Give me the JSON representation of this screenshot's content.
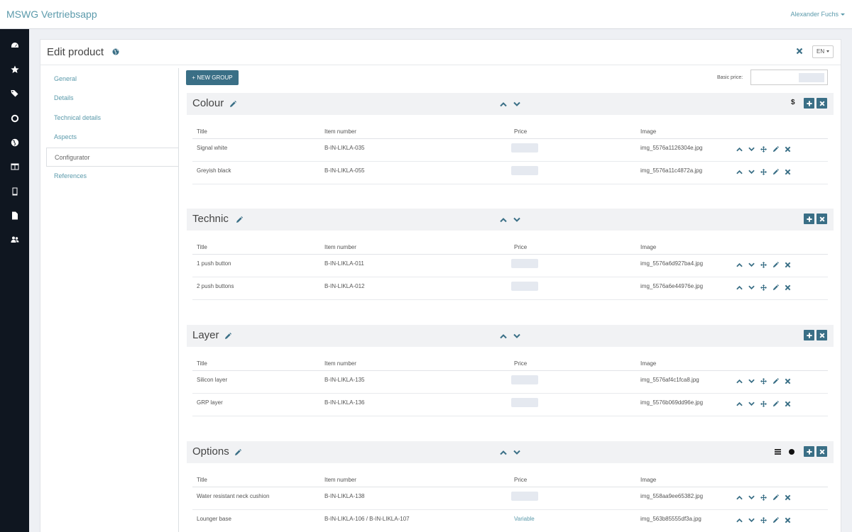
{
  "app": {
    "brand": "MSWG Vertriebsapp",
    "user": "Alexander Fuchs"
  },
  "sidebar_icons": [
    "dashboard-icon",
    "star-icon",
    "tags-icon",
    "circle-icon",
    "globe-icon",
    "table-icon",
    "tablet-icon",
    "file-icon",
    "users-icon"
  ],
  "panel": {
    "title": "Edit product",
    "lang": "EN"
  },
  "subnav": [
    {
      "label": "General",
      "active": false
    },
    {
      "label": "Details",
      "active": false
    },
    {
      "label": "Technical details",
      "active": false
    },
    {
      "label": "Aspects",
      "active": false
    },
    {
      "label": "Configurator",
      "active": true
    },
    {
      "label": "References",
      "active": false
    }
  ],
  "toolbar": {
    "new_group": "NEW GROUP",
    "basic_price_label": "Basic price:"
  },
  "columns": {
    "title": "Title",
    "item": "Item number",
    "price": "Price",
    "image": "Image"
  },
  "groups": [
    {
      "name": "Colour",
      "rows": [
        {
          "title": "Signal white",
          "item": "B-IN-LIKLA-035",
          "price": "",
          "image": "img_5576a1126304e.jpg"
        },
        {
          "title": "Greyish black",
          "item": "B-IN-LIKLA-055",
          "price": "",
          "image": "img_5576a11c4872a.jpg"
        }
      ]
    },
    {
      "name": "Technic",
      "rows": [
        {
          "title": "1 push button",
          "item": "B-IN-LIKLA-011",
          "price": "",
          "image": "img_5576a6d927ba4.jpg"
        },
        {
          "title": "2 push buttons",
          "item": "B-IN-LIKLA-012",
          "price": "",
          "image": "img_5576a6e44976e.jpg"
        }
      ]
    },
    {
      "name": "Layer",
      "rows": [
        {
          "title": "Silicon layer",
          "item": "B-IN-LIKLA-135",
          "price": "",
          "image": "img_5576af4c1fca8.jpg"
        },
        {
          "title": "GRP layer",
          "item": "B-IN-LIKLA-136",
          "price": "",
          "image": "img_5576b069dd96e.jpg"
        }
      ]
    },
    {
      "name": "Options",
      "rows": [
        {
          "title": "Water resistant neck cushion",
          "item": "B-IN-LIKLA-138",
          "price": "",
          "image": "img_558aa9ee65382.jpg"
        },
        {
          "title": "Lounger base",
          "item": "B-IN-LIKLA-106 / B-IN-LIKLA-107",
          "price": "Variable",
          "image": "img_563b85555df3a.jpg"
        }
      ]
    }
  ],
  "colors": {
    "accent": "#3a6f86",
    "link": "#5b9aab",
    "sidebar": "#0f1620"
  }
}
